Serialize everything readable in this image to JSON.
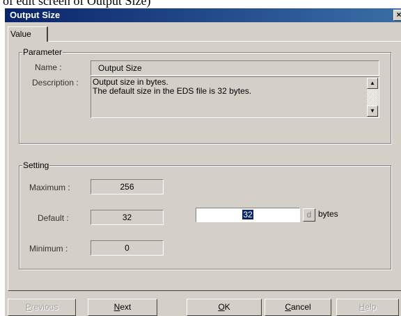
{
  "caption": "of edit screen of Output Size)",
  "window": {
    "title": "Output Size",
    "close_glyph": "×"
  },
  "tabs": [
    {
      "label": "Value",
      "active": true
    }
  ],
  "parameter": {
    "legend": "Parameter",
    "name_label": "Name :",
    "name_value": "Output Size",
    "description_label": "Description :",
    "description_lines": [
      "Output size in bytes.",
      "The default size in the EDS file is 32 bytes."
    ]
  },
  "setting": {
    "legend": "Setting",
    "maximum_label": "Maximum :",
    "maximum_value": "256",
    "default_label": "Default :",
    "default_value": "32",
    "minimum_label": "Minimum :",
    "minimum_value": "0",
    "input_value": "32",
    "radix_button": "d",
    "unit": "bytes"
  },
  "buttons": {
    "previous": {
      "mnemonic": "P",
      "rest": "revious",
      "enabled": false
    },
    "next": {
      "mnemonic": "N",
      "rest": "ext",
      "enabled": true
    },
    "ok": {
      "mnemonic": "O",
      "rest": "K",
      "enabled": true
    },
    "cancel": {
      "mnemonic": "C",
      "rest": "ancel",
      "enabled": true
    },
    "help": {
      "mnemonic": "H",
      "rest": "elp",
      "enabled": false
    }
  },
  "colors": {
    "titlebar_start": "#0a246a",
    "titlebar_end": "#3a6ea5",
    "dialog_face": "#d4d0c8",
    "selection": "#0a246a"
  }
}
